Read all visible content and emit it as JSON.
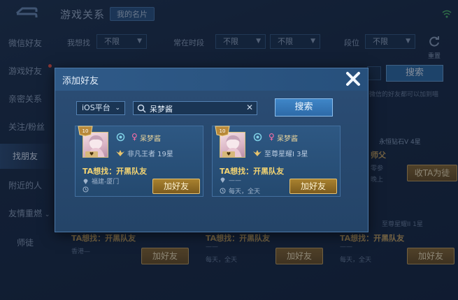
{
  "background": {
    "app_title": "游戏关系",
    "tab": "我的名片",
    "sidebar": {
      "items": [
        {
          "label": "微信好友"
        },
        {
          "label": "游戏好友"
        },
        {
          "label": "亲密关系"
        },
        {
          "label": "关注/粉丝"
        },
        {
          "label": "找朋友"
        },
        {
          "label": "附近的人"
        },
        {
          "label": "友情重燃"
        },
        {
          "label": "师徒"
        }
      ],
      "active_index": 4
    },
    "filters": [
      {
        "label": "我想找",
        "value": "不限"
      },
      {
        "label": "常在时段",
        "value": "不限",
        "value2": "不限"
      },
      {
        "label": "段位",
        "value": "不限"
      }
    ],
    "reset_label": "重置",
    "search_label": "搜索",
    "hint": "微信的好友都可以加到喵",
    "right_card": {
      "title": "师父",
      "tier": "永恒钻石V 4星",
      "line1": "零参",
      "line2": "晚上",
      "button": "收TA为徒",
      "tier2": "至尊星耀II 1星"
    },
    "bottom_cards": [
      {
        "want": "TA想找：开黑队友",
        "loc": "香港—",
        "button": "加好友"
      },
      {
        "want": "TA想找：开黑队友",
        "loc": "——",
        "time": "每天，全天",
        "button": "加好友"
      },
      {
        "want": "TA想找：开黑队友",
        "loc": "——",
        "time": "每天，全天",
        "button": "加好友"
      }
    ]
  },
  "modal": {
    "title": "添加好友",
    "platform": "iOS平台",
    "search_value": "呆梦酱",
    "search_button": "搜索",
    "cards": [
      {
        "level": "10",
        "name": "呆梦酱",
        "tier": "非凡王者 19星",
        "want": "TA想找：开黑队友",
        "location": "福建-厦门",
        "time": "",
        "button": "加好友"
      },
      {
        "level": "10",
        "name": "呆梦酱",
        "tier": "至尊星耀I 3星",
        "want": "TA想找：开黑队友",
        "location": "——",
        "time": "每天，全天",
        "button": "加好友"
      }
    ]
  },
  "colors": {
    "accent_gold": "#c9a560",
    "accent_blue": "#3f86c8",
    "want_text": "#f4d472",
    "female_pink": "#ff6fa7"
  },
  "icons": [
    "back-icon",
    "wifi-icon",
    "reset-icon",
    "close-icon",
    "search-icon",
    "clear-icon",
    "chevron-down-icon",
    "rank-badge-icon",
    "ring-icon",
    "female-icon",
    "tier-icon",
    "location-icon",
    "clock-icon"
  ]
}
